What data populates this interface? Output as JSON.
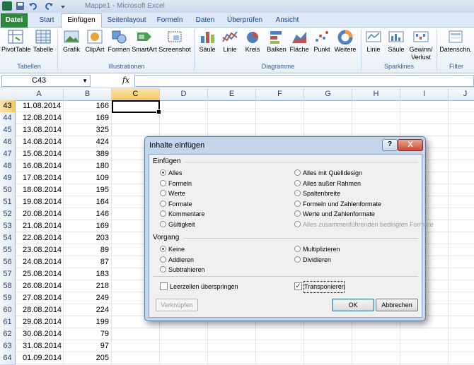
{
  "window": {
    "title": "Mappe1 - Microsoft Excel"
  },
  "tabs": [
    "Datei",
    "Start",
    "Einfügen",
    "Seitenlayout",
    "Formeln",
    "Daten",
    "Überprüfen",
    "Ansicht"
  ],
  "ribbon": {
    "groups": {
      "tabellen": "Tabellen",
      "illustrationen": "Illustrationen",
      "diagramme": "Diagramme",
      "sparklines": "Sparklines",
      "filter": "Filter"
    },
    "buttons": {
      "pivottable": "PivotTable",
      "tabelle": "Tabelle",
      "grafik": "Grafik",
      "clipart": "ClipArt",
      "formen": "Formen",
      "smartart": "SmartArt",
      "screenshot": "Screenshot",
      "saeule": "Säule",
      "linie": "Linie",
      "kreis": "Kreis",
      "balken": "Balken",
      "flaeche": "Fläche",
      "punkt": "Punkt",
      "weitere": "Weitere",
      "spark_linie": "Linie",
      "spark_saeule": "Säule",
      "spark_gewinn": "Gewinn/",
      "spark_verlust": "Verlust",
      "datenschn": "Datenschn."
    }
  },
  "formula_bar": {
    "name_box": "C43",
    "fx": "fx",
    "value": ""
  },
  "columns": [
    "A",
    "B",
    "C",
    "D",
    "E",
    "F",
    "G",
    "H",
    "I",
    "J"
  ],
  "selected_column": "C",
  "rows": [
    {
      "n": "43",
      "date": "11.08.2014",
      "val": "166"
    },
    {
      "n": "44",
      "date": "12.08.2014",
      "val": "169"
    },
    {
      "n": "45",
      "date": "13.08.2014",
      "val": "325"
    },
    {
      "n": "46",
      "date": "14.08.2014",
      "val": "424"
    },
    {
      "n": "47",
      "date": "15.08.2014",
      "val": "389"
    },
    {
      "n": "48",
      "date": "16.08.2014",
      "val": "180"
    },
    {
      "n": "49",
      "date": "17.08.2014",
      "val": "109"
    },
    {
      "n": "50",
      "date": "18.08.2014",
      "val": "195"
    },
    {
      "n": "51",
      "date": "19.08.2014",
      "val": "164"
    },
    {
      "n": "52",
      "date": "20.08.2014",
      "val": "146"
    },
    {
      "n": "53",
      "date": "21.08.2014",
      "val": "169"
    },
    {
      "n": "54",
      "date": "22.08.2014",
      "val": "203"
    },
    {
      "n": "55",
      "date": "23.08.2014",
      "val": "89"
    },
    {
      "n": "56",
      "date": "24.08.2014",
      "val": "87"
    },
    {
      "n": "57",
      "date": "25.08.2014",
      "val": "183"
    },
    {
      "n": "58",
      "date": "26.08.2014",
      "val": "218"
    },
    {
      "n": "59",
      "date": "27.08.2014",
      "val": "249"
    },
    {
      "n": "60",
      "date": "28.08.2014",
      "val": "224"
    },
    {
      "n": "61",
      "date": "29.08.2014",
      "val": "199"
    },
    {
      "n": "62",
      "date": "30.08.2014",
      "val": "79"
    },
    {
      "n": "63",
      "date": "31.08.2014",
      "val": "97"
    },
    {
      "n": "64",
      "date": "01.09.2014",
      "val": "205"
    }
  ],
  "dialog": {
    "title": "Inhalte einfügen",
    "help": "?",
    "close": "X",
    "section_paste": "Einfügen",
    "paste_left": [
      "Alles",
      "Formeln",
      "Werte",
      "Formate",
      "Kommentare",
      "Gültigkeit"
    ],
    "paste_right": [
      "Alles mit Quelldesign",
      "Alles außer Rahmen",
      "Spaltenbreite",
      "Formeln und Zahlenformate",
      "Werte und Zahlenformate",
      "Alles zusammenführenden bedingten Formate"
    ],
    "section_operation": "Vorgang",
    "op_left": [
      "Keine",
      "Addieren",
      "Subtrahieren"
    ],
    "op_right": [
      "Multiplizieren",
      "Dividieren"
    ],
    "skip_blanks": "Leerzellen überspringen",
    "transpose": "Transponieren",
    "link_button": "Verknüpfen",
    "ok_button": "OK",
    "cancel_button": "Abbrechen"
  }
}
